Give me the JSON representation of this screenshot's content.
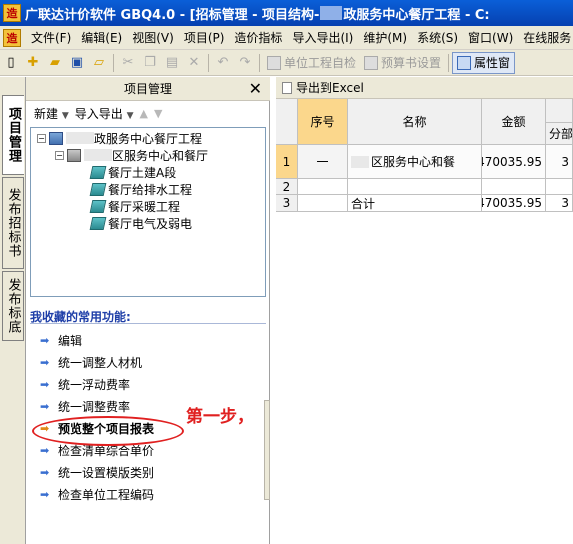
{
  "title": {
    "text": "广联达计价软件 GBQ4.0 - [招标管理 - 项目结构-",
    "text_suffix": "政服务中心餐厅工程 - C:"
  },
  "menu": {
    "items": [
      "文件(F)",
      "编辑(E)",
      "视图(V)",
      "项目(P)",
      "造价指标",
      "导入导出(I)",
      "维护(M)",
      "系统(S)",
      "窗口(W)",
      "在线服务"
    ]
  },
  "toolbar": {
    "unit_check": "单位工程自检",
    "budget_settings": "预算书设置",
    "properties": "属性窗"
  },
  "vtabs": [
    "项目管理",
    "发布招标书",
    "发布标底"
  ],
  "panel": {
    "title": "项目管理",
    "new_label": "新建",
    "import_export_label": "导入导出"
  },
  "tree": {
    "root": "政服务中心餐厅工程",
    "section": "区服务中心和餐厅",
    "units": [
      "餐厅土建A段",
      "餐厅给排水工程",
      "餐厅采暖工程",
      "餐厅电气及弱电"
    ]
  },
  "favorites": {
    "title": "我收藏的常用功能:",
    "items": [
      "编辑",
      "统一调整人材机",
      "统一浮动费率",
      "统一调整费率",
      "预览整个项目报表",
      "检查清单综合单价",
      "统一设置模版类别",
      "检查单位工程编码"
    ]
  },
  "annotation": {
    "text": "第一步，"
  },
  "table": {
    "export_label": "导出到Excel",
    "headers": {
      "seq": "序号",
      "name": "名称",
      "amount": "金额",
      "sub": "分部"
    },
    "rows": [
      {
        "num": "1",
        "seq": "一",
        "name": "区服务中心和餐",
        "amount": "470035.95",
        "extra": "3"
      },
      {
        "num": "2",
        "seq": "",
        "name": "",
        "amount": "",
        "extra": ""
      },
      {
        "num": "3",
        "seq": "",
        "name": "合计",
        "amount": "470035.95",
        "extra": "3"
      }
    ]
  }
}
